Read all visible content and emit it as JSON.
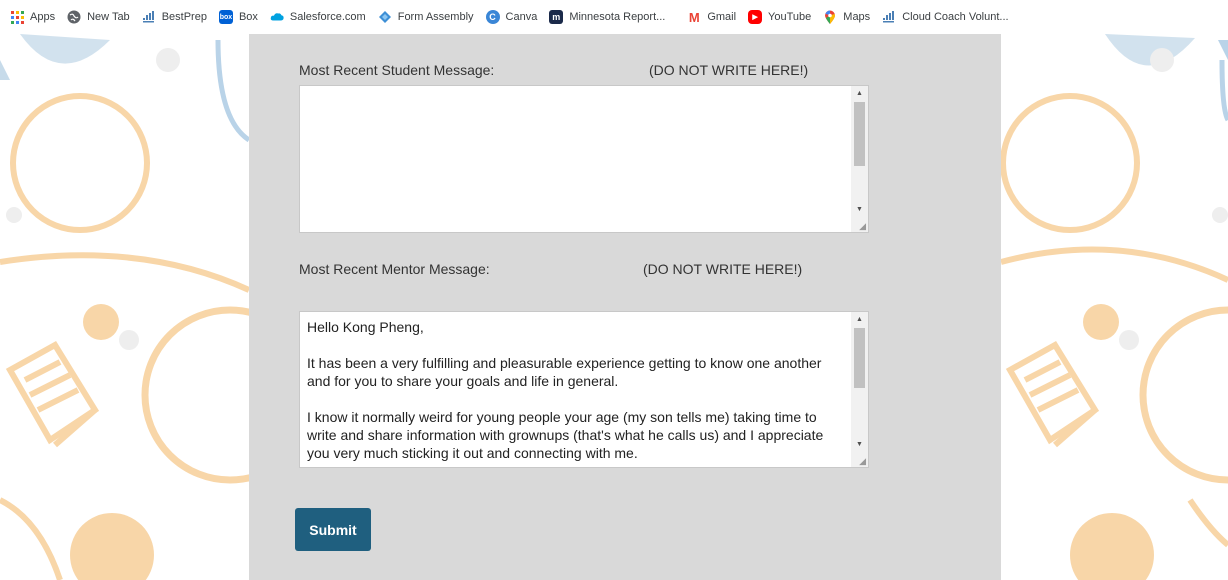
{
  "bookmarks": [
    {
      "label": "Apps",
      "icon": "apps-grid-icon",
      "color": "#e8453c"
    },
    {
      "label": "New Tab",
      "icon": "globe-icon",
      "color": "#5f6368"
    },
    {
      "label": "BestPrep",
      "icon": "bestprep-icon",
      "color": "#4a7fb5"
    },
    {
      "label": "Box",
      "icon": "box-icon",
      "color": "#0061d5",
      "glyph": "box"
    },
    {
      "label": "Salesforce.com",
      "icon": "salesforce-cloud-icon",
      "color": "#00a1e0"
    },
    {
      "label": "Form Assembly",
      "icon": "form-assembly-icon",
      "color": "#3d8fd6"
    },
    {
      "label": "Canva",
      "icon": "canva-icon",
      "color": "#3a86d6",
      "glyph": "C"
    },
    {
      "label": "Minnesota Report...",
      "icon": "minnesota-reformer-icon",
      "color": "#1b2a4a",
      "glyph": "m"
    },
    {
      "label": "Gmail",
      "icon": "gmail-icon",
      "color": "#ea4335",
      "glyph": "M"
    },
    {
      "label": "YouTube",
      "icon": "youtube-icon",
      "color": "#ff0000",
      "glyph": "▶"
    },
    {
      "label": "Maps",
      "icon": "maps-pin-icon",
      "color": "#34a853"
    },
    {
      "label": "Cloud Coach Volunt...",
      "icon": "cloud-coach-icon",
      "color": "#4a7fb5"
    }
  ],
  "form": {
    "student_label": "Most Recent Student Message:",
    "student_note": "(DO NOT WRITE HERE!)",
    "student_message": "",
    "mentor_label": "Most Recent Mentor Message:",
    "mentor_note": "(DO NOT WRITE HERE!)",
    "mentor_message": "Hello Kong Pheng,\n\nIt has been a very fulfilling and pleasurable experience getting to know one another\nand for you to share your goals and life in general.\n\nI know it normally weird for young people your age (my son tells me) taking time to\nwrite and share information with grownups (that's what he calls us) and I appreciate\nyou very much sticking it out and connecting with me.",
    "submit_label": "Submit"
  },
  "colors": {
    "panel": "#d9d9d9",
    "submit": "#1f5f7f",
    "deco_orange": "#f8d6a8",
    "deco_blue": "#b9d3e8"
  }
}
